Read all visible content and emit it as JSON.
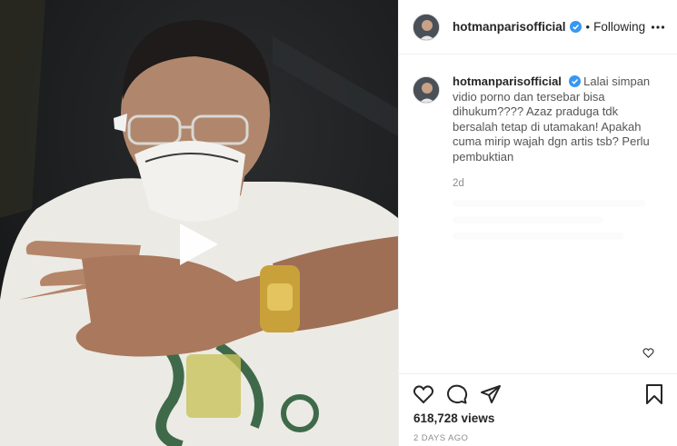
{
  "header": {
    "username": "hotmanparisofficial",
    "separator": "•",
    "follow_status": "Following"
  },
  "caption": {
    "username": "hotmanparisofficial",
    "text": "Lalai simpan vidio porno dan tersebar bisa dihukum???? Azaz praduga tdk bersalah tetap di utamakan! Apakah cuma mirip wajah dgn artis tsb? Perlu pembuktian",
    "age": "2d"
  },
  "stats": {
    "views": "618,728 views",
    "date": "2 DAYS AGO"
  },
  "icons": {
    "verified": "verified-badge-icon",
    "more": "more-options-icon",
    "play": "play-icon",
    "comment_like": "heart-icon",
    "like": "heart-icon",
    "comment": "comment-icon",
    "share": "share-icon",
    "save": "bookmark-icon"
  },
  "colors": {
    "verified_blue": "#3897f0",
    "text": "#262626",
    "secondary_text": "#8e8e8e",
    "divider": "#efefef"
  }
}
